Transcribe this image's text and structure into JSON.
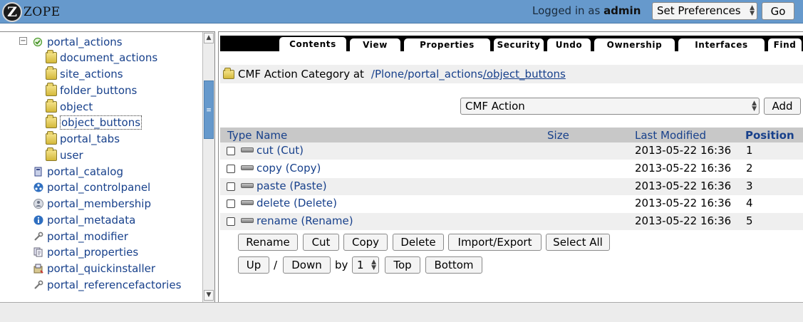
{
  "header": {
    "logo_text": "ZOPE",
    "logo_letter": "Z",
    "logged_prefix": "Logged in as",
    "username": "admin",
    "preferences_select": "Set Preferences",
    "go_button": "Go"
  },
  "tree": {
    "root": "portal_actions",
    "children": [
      "document_actions",
      "site_actions",
      "folder_buttons",
      "object",
      "object_buttons",
      "portal_tabs",
      "user"
    ],
    "items": [
      "portal_catalog",
      "portal_controlpanel",
      "portal_membership",
      "portal_metadata",
      "portal_modifier",
      "portal_properties",
      "portal_quickinstaller",
      "portal_referencefactories"
    ]
  },
  "tabs": [
    "Contents",
    "View",
    "Properties",
    "Security",
    "Undo",
    "Ownership",
    "Interfaces",
    "Find"
  ],
  "breadcrumb": {
    "prefix": "CMF Action Category at",
    "parts": [
      "/Plone",
      "/portal_actions",
      "/object_buttons"
    ]
  },
  "add_form": {
    "select_value": "CMF Action",
    "add_button": "Add"
  },
  "table": {
    "headers": {
      "type": "Type",
      "name": "Name",
      "size": "Size",
      "modified": "Last Modified",
      "position": "Position"
    },
    "rows": [
      {
        "name": "cut (Cut)",
        "modified": "2013-05-22 16:36",
        "position": "1"
      },
      {
        "name": "copy (Copy)",
        "modified": "2013-05-22 16:36",
        "position": "2"
      },
      {
        "name": "paste (Paste)",
        "modified": "2013-05-22 16:36",
        "position": "3"
      },
      {
        "name": "delete (Delete)",
        "modified": "2013-05-22 16:36",
        "position": "4"
      },
      {
        "name": "rename (Rename)",
        "modified": "2013-05-22 16:36",
        "position": "5"
      }
    ]
  },
  "actions": {
    "rename": "Rename",
    "cut": "Cut",
    "copy": "Copy",
    "delete": "Delete",
    "import_export": "Import/Export",
    "select_all": "Select All",
    "up": "Up",
    "slash": "/",
    "down": "Down",
    "by": "by",
    "by_value": "1",
    "top": "Top",
    "bottom": "Bottom"
  }
}
